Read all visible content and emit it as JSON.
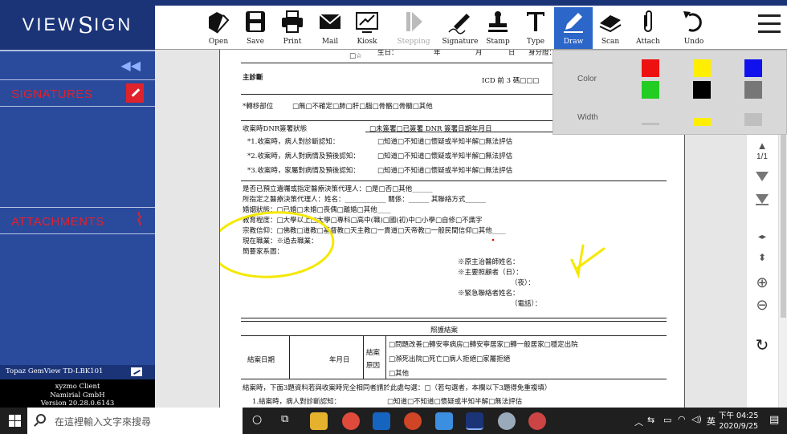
{
  "brand": {
    "logo_text_left": "VIEW",
    "logo_glyph": "S",
    "logo_text_right": "IGN"
  },
  "sidebar": {
    "collapse_icon": "double-chevron-left-icon",
    "sections": [
      {
        "label": "SIGNATURES",
        "icon": "edit-square-icon"
      },
      {
        "label": "ATTACHMENTS",
        "icon": "paperclip-icon"
      }
    ],
    "device": "Topaz GemView TD-LBK101",
    "version_lines": [
      "xyzmo Client",
      "Namirial GmbH",
      "Version 20.28.0.6143"
    ]
  },
  "toolbar": {
    "tools": [
      {
        "label": "Open",
        "icon": "folder-open-icon"
      },
      {
        "label": "Save",
        "icon": "floppy-icon"
      },
      {
        "label": "Print",
        "icon": "printer-icon"
      },
      {
        "label": "Mail",
        "icon": "envelope-icon"
      },
      {
        "label": "Kiosk",
        "icon": "kiosk-icon"
      },
      {
        "label": "Stepping",
        "icon": "step-forward-icon"
      },
      {
        "label": "Signature",
        "icon": "pen-signature-icon"
      },
      {
        "label": "Stamp",
        "icon": "stamp-icon"
      },
      {
        "label": "Type",
        "icon": "text-type-icon"
      },
      {
        "label": "Draw",
        "icon": "pencil-icon"
      },
      {
        "label": "Scan",
        "icon": "scanner-icon"
      },
      {
        "label": "Attach",
        "icon": "paperclip-icon"
      },
      {
        "label": "Undo",
        "icon": "undo-icon"
      }
    ],
    "menu_icon": "hamburger-menu-icon"
  },
  "draw_panel": {
    "color_label": "Color",
    "width_label": "Width",
    "colors": [
      "#ee1111",
      "#ffee00",
      "#1111ee",
      "#22cc22",
      "#000000",
      "#777777"
    ],
    "selected_width_color": "#ffee00"
  },
  "document": {
    "row_a": {
      "mark": "□☆",
      "label": "生日：",
      "year": "年",
      "month": "月",
      "day": "日",
      "tail": "身分證："
    },
    "diagnosis_label": "主診斷",
    "icd": "ICD 前 3 碼□□□",
    "transfer_label": "*轉移部位",
    "transfer_options": "□無□不確定□肺□肝□腦□骨骼□骨髓□其他",
    "dnr_label": "收案時DNR簽署狀態",
    "dnr_options": "□未簽署□已簽署 DNR 簽署日期年月日",
    "q1": "*1.收案時，病人對診斷認知：",
    "q2": "*2.收案時，病人對病情及預後認知：",
    "q3": "*3.收案時，家屬對病情及預後認知：",
    "q_options": "□知道□不知道□懷疑或半知半解□無法評估",
    "proxy1": "是否已預立遺囑或指定醫療決策代理人：□是□否□其他______",
    "proxy2": "所指定之醫療決策代理人：姓名：____________  關係：______ 其聯絡方式______",
    "marital": "婚姻狀態：□已婚□未婚□喪偶□離婚□其他____",
    "education": "教育程度：□大學以上□大學□專科□高中(職)□國(初)中□小學□自修□不識字",
    "religion": "宗教信仰：□佛教□道教□基督教□天主教□一貫道□天帝教□一般民間信仰□其他____",
    "job": "現在職業：※過去職業：",
    "family": "簡要家系圖：",
    "contact1": "※原主治醫師姓名：",
    "contact2": "※主要照顧者（日）：",
    "contact3": "（夜）：",
    "contact4": "※緊急聯絡者姓名：",
    "contact5": "（電話）：",
    "care_title": "照護結案",
    "end_date_label": "結案日期",
    "ymd": "年月日",
    "reason_label": "結案原因",
    "reason_1": "□問題改善□轉安寧病房□轉安寧居家□轉一般居家□穩定出院",
    "reason_2": "□瀕死出院□死亡□病人拒絕□家屬拒絕",
    "reason_3": "□其他",
    "end_note": "結案時，下面3題資料若與收案時完全相同者請於此處勾選：□（若勾選者，本欄以下3題得免重複填）",
    "end_q1": "1.結案時，病人對診斷認知：",
    "end_q1_opts": "□知道□不知道□懷疑或半知半解□無法評估"
  },
  "right_controls": {
    "page_indicator": "1/1"
  },
  "taskbar": {
    "search_placeholder": "在這裡輸入文字來搜尋",
    "ime": "英",
    "time": "下午 04:25",
    "date": "2020/9/25"
  }
}
